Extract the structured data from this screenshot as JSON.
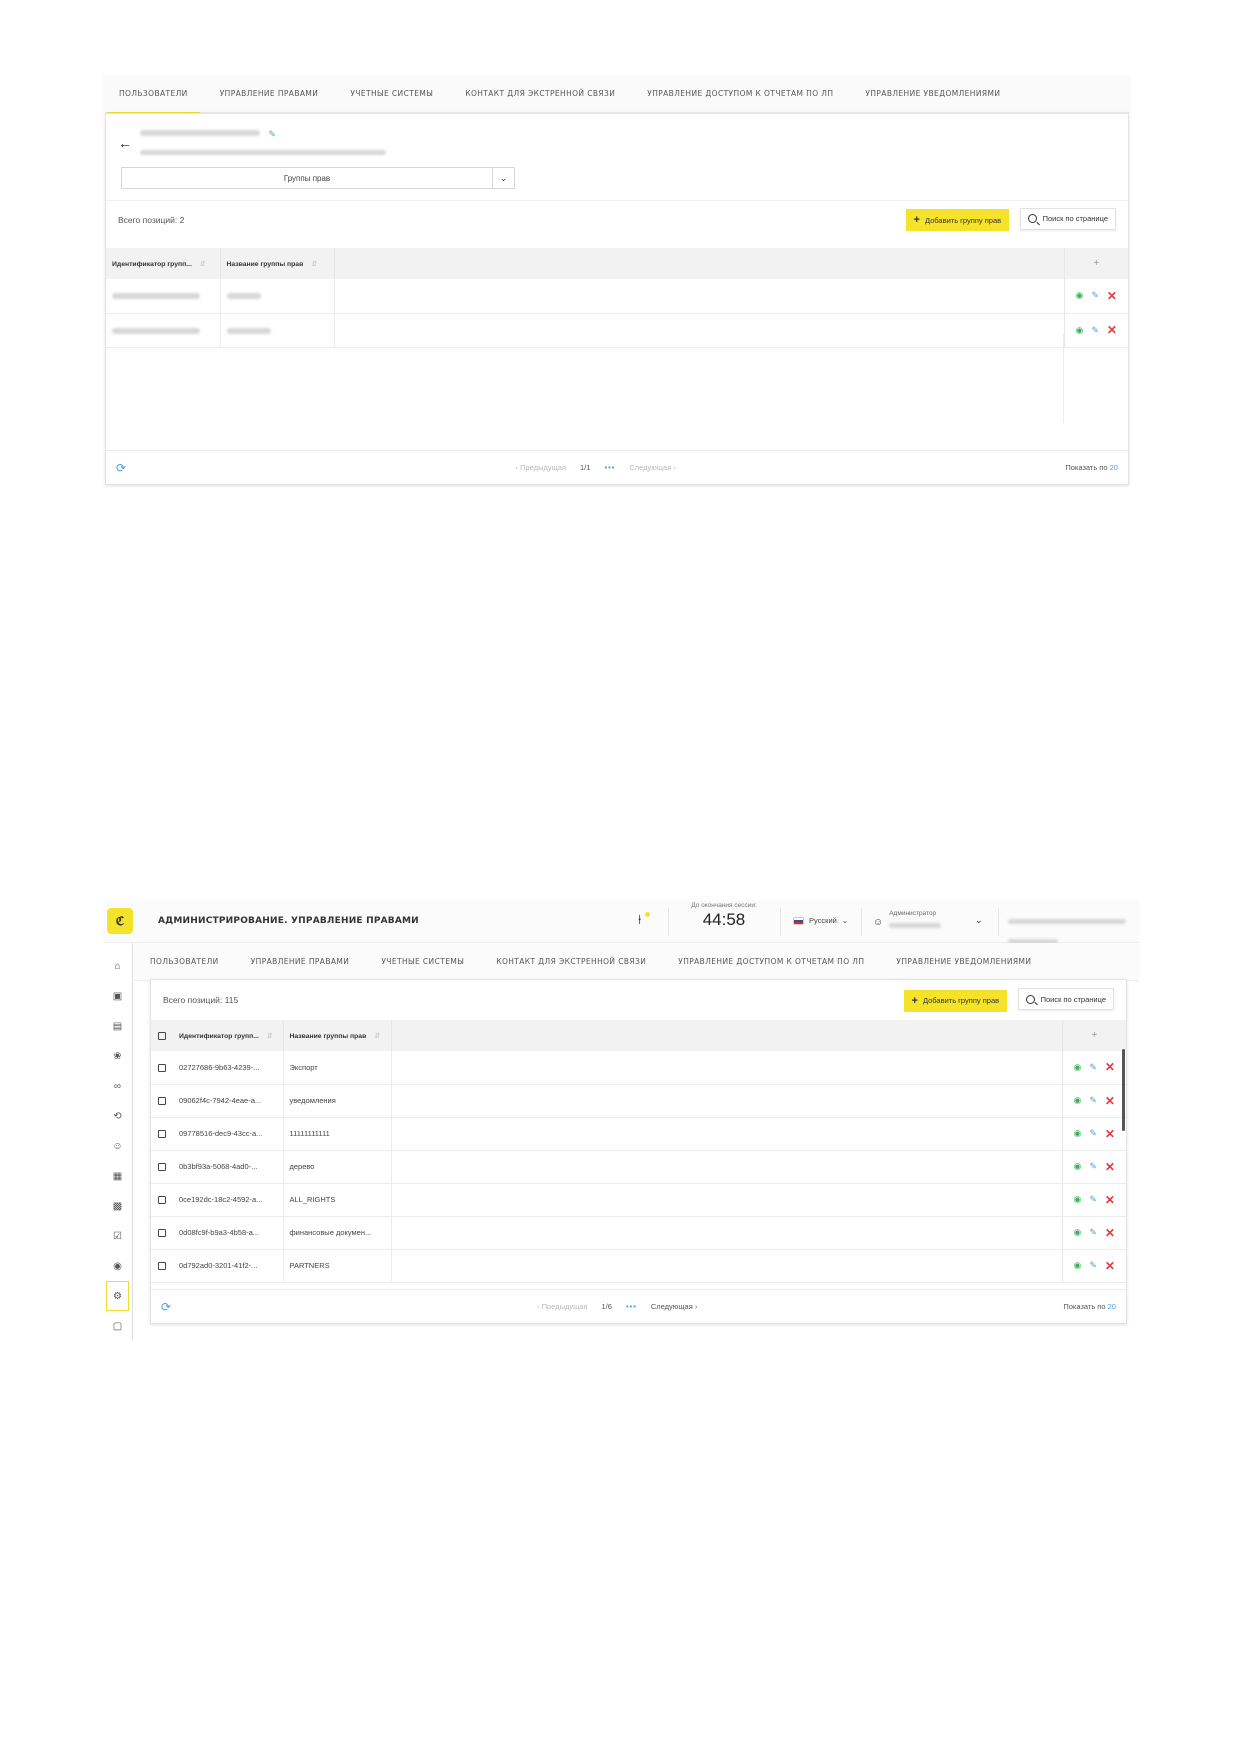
{
  "tabs": [
    {
      "label": "ПОЛЬЗОВАТЕЛИ"
    },
    {
      "label": "УПРАВЛЕНИЕ ПРАВАМИ"
    },
    {
      "label": "УЧЕТНЫЕ СИСТЕМЫ"
    },
    {
      "label": "КОНТАКТ ДЛЯ ЭКСТРЕННОЙ СВЯЗИ"
    },
    {
      "label": "УПРАВЛЕНИЕ ДОСТУПОМ К ОТЧЕТАМ ПО ЛП"
    },
    {
      "label": "УПРАВЛЕНИЕ УВЕДОМЛЕНИЯМИ"
    }
  ],
  "screen1": {
    "active_tab": "ПОЛЬЗОВАТЕЛИ",
    "select_value": "Группы прав",
    "total": "Всего позиций: 2",
    "add_label": "Добавить группу прав",
    "search_label": "Поиск по странице",
    "columns": [
      "Идентификатор групп...",
      "Название группы прав"
    ],
    "add_column": "+",
    "pager": {
      "prev": "Предыдущая",
      "page": "1/1",
      "dots": "•••",
      "next": "Следующая",
      "page_size_label": "Показать по",
      "page_size": "20"
    }
  },
  "screen2": {
    "app_title": "АДМИНИСТРИРОВАНИЕ. УПРАВЛЕНИЕ ПРАВАМИ",
    "session_label": "До окончания сессии:",
    "session_time": "44:58",
    "language": "Русский",
    "user_role": "Администратор",
    "active_tab": "УПРАВЛЕНИЕ ПРАВАМИ",
    "total": "Всего позиций: 115",
    "add_label": "Добавить группу прав",
    "search_label": "Поиск по странице",
    "columns": [
      "Идентификатор групп...",
      "Название группы прав"
    ],
    "add_column": "+",
    "rows": [
      {
        "id": "02727686-9b63-4239-...",
        "name": "Экспорт"
      },
      {
        "id": "09062f4c-7942-4eae-a...",
        "name": "уведомления"
      },
      {
        "id": "09778516-dec9-43cc-a...",
        "name": "11111111111"
      },
      {
        "id": "0b3bf93a-5068-4ad0-...",
        "name": "дерево"
      },
      {
        "id": "0ce192dc-18c2-4592-a...",
        "name": "ALL_RIGHTS"
      },
      {
        "id": "0d08fc9f-b9a3-4b58-a...",
        "name": "финансовые докумен..."
      },
      {
        "id": "0d792ad0-3201-41f2-...",
        "name": "PARTNERS"
      }
    ],
    "pager": {
      "prev": "Предыдущая",
      "page": "1/6",
      "dots": "•••",
      "next": "Следующая",
      "page_size_label": "Показать по",
      "page_size": "20"
    }
  },
  "icons": {
    "back": "arrow-left-icon",
    "edit": "pencil-icon",
    "view": "eye-icon",
    "delete": "close-icon",
    "refresh": "refresh-icon"
  },
  "colors": {
    "accent": "#f5e22b",
    "view": "#3cae5c",
    "edit": "#4aa3d9",
    "delete": "#e23b3b"
  }
}
